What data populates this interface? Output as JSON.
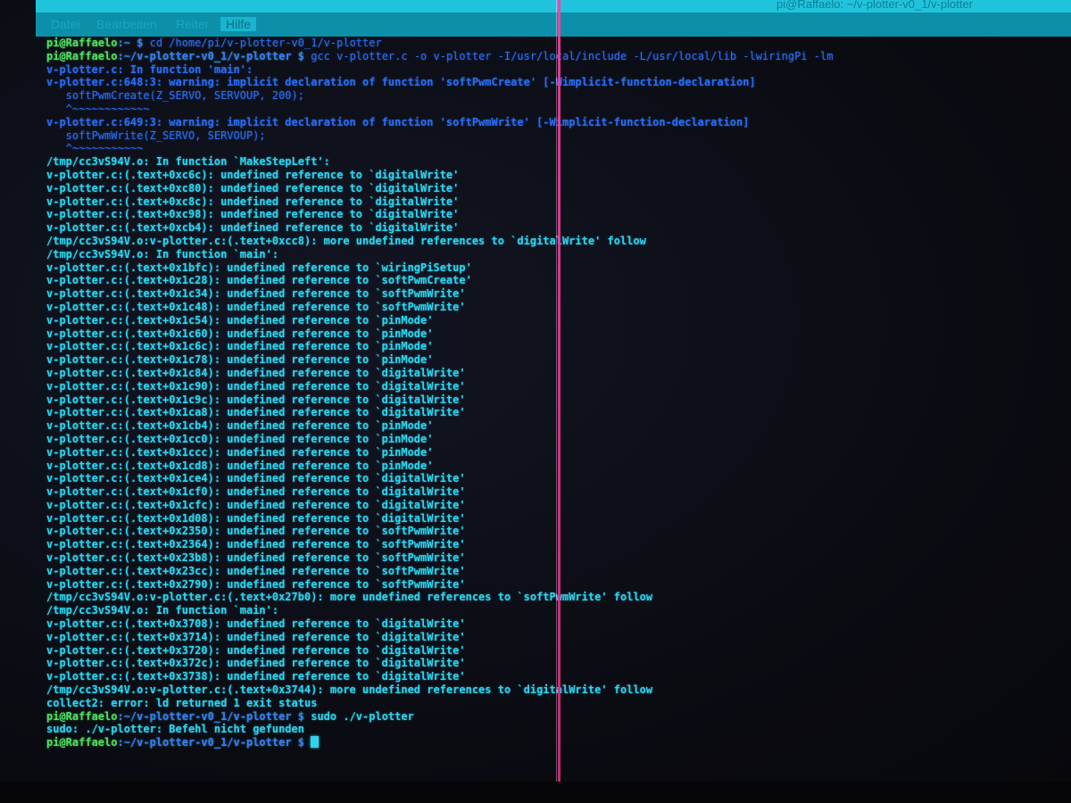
{
  "window": {
    "title": "pi@Raffaelo: ~/v-plotter-v0_1/v-plotter"
  },
  "menu": {
    "items": [
      "Datei",
      "Bearbeiten",
      "Reiter",
      "Hilfe"
    ]
  },
  "colors": {
    "titlebar": "#1fc4dc",
    "menubar": "#0c8fa9",
    "background": "#0c0d14",
    "text": "#2fd3ee",
    "prompt_user": "#4fe060",
    "prompt_path": "#3b7cf5",
    "cursor": "#2fd3ee",
    "artifact_line": "#ff3ea8"
  },
  "terminal": {
    "prompt1": {
      "user": "pi@Raffaelo",
      "path": ":~ $",
      "command": " cd /home/pi/v-plotter-v0_1/v-plotter"
    },
    "prompt2": {
      "user": "pi@Raffaelo",
      "path": ":~/v-plotter-v0_1/v-plotter $",
      "command": " gcc v-plotter.c -o v-plotter -I/usr/local/include -L/usr/local/lib -lwiringPi -lm"
    },
    "warnings": {
      "in_function": "v-plotter.c: In function 'main':",
      "w1": "v-plotter.c:648:3: warning: implicit declaration of function 'softPwmCreate' [-Wimplicit-function-declaration]",
      "w1_code": "   softPwmCreate(Z_SERVO, SERVOUP, 200);",
      "w1_marker": "   ^~~~~~~~~~~~~",
      "w2": "v-plotter.c:649:3: warning: implicit declaration of function 'softPwmWrite' [-Wimplicit-function-declaration]",
      "w2_code": "   softPwmWrite(Z_SERVO, SERVOUP);",
      "w2_marker": "   ^~~~~~~~~~~~"
    },
    "linker_lines": [
      "/tmp/cc3vS94V.o: In function `MakeStepLeft':",
      "v-plotter.c:(.text+0xc6c): undefined reference to `digitalWrite'",
      "v-plotter.c:(.text+0xc80): undefined reference to `digitalWrite'",
      "v-plotter.c:(.text+0xc8c): undefined reference to `digitalWrite'",
      "v-plotter.c:(.text+0xc98): undefined reference to `digitalWrite'",
      "v-plotter.c:(.text+0xcb4): undefined reference to `digitalWrite'",
      "/tmp/cc3vS94V.o:v-plotter.c:(.text+0xcc8): more undefined references to `digitalWrite' follow",
      "/tmp/cc3vS94V.o: In function `main':",
      "v-plotter.c:(.text+0x1bfc): undefined reference to `wiringPiSetup'",
      "v-plotter.c:(.text+0x1c28): undefined reference to `softPwmCreate'",
      "v-plotter.c:(.text+0x1c34): undefined reference to `softPwmWrite'",
      "v-plotter.c:(.text+0x1c48): undefined reference to `softPwmWrite'",
      "v-plotter.c:(.text+0x1c54): undefined reference to `pinMode'",
      "v-plotter.c:(.text+0x1c60): undefined reference to `pinMode'",
      "v-plotter.c:(.text+0x1c6c): undefined reference to `pinMode'",
      "v-plotter.c:(.text+0x1c78): undefined reference to `pinMode'",
      "v-plotter.c:(.text+0x1c84): undefined reference to `digitalWrite'",
      "v-plotter.c:(.text+0x1c90): undefined reference to `digitalWrite'",
      "v-plotter.c:(.text+0x1c9c): undefined reference to `digitalWrite'",
      "v-plotter.c:(.text+0x1ca8): undefined reference to `digitalWrite'",
      "v-plotter.c:(.text+0x1cb4): undefined reference to `pinMode'",
      "v-plotter.c:(.text+0x1cc0): undefined reference to `pinMode'",
      "v-plotter.c:(.text+0x1ccc): undefined reference to `pinMode'",
      "v-plotter.c:(.text+0x1cd8): undefined reference to `pinMode'",
      "v-plotter.c:(.text+0x1ce4): undefined reference to `digitalWrite'",
      "v-plotter.c:(.text+0x1cf0): undefined reference to `digitalWrite'",
      "v-plotter.c:(.text+0x1cfc): undefined reference to `digitalWrite'",
      "v-plotter.c:(.text+0x1d08): undefined reference to `digitalWrite'",
      "v-plotter.c:(.text+0x2350): undefined reference to `softPwmWrite'",
      "v-plotter.c:(.text+0x2364): undefined reference to `softPwmWrite'",
      "v-plotter.c:(.text+0x23b8): undefined reference to `softPwmWrite'",
      "v-plotter.c:(.text+0x23cc): undefined reference to `softPwmWrite'",
      "v-plotter.c:(.text+0x2790): undefined reference to `softPwmWrite'",
      "/tmp/cc3vS94V.o:v-plotter.c:(.text+0x27b0): more undefined references to `softPwmWrite' follow",
      "/tmp/cc3vS94V.o: In function `main':",
      "v-plotter.c:(.text+0x3708): undefined reference to `digitalWrite'",
      "v-plotter.c:(.text+0x3714): undefined reference to `digitalWrite'",
      "v-plotter.c:(.text+0x3720): undefined reference to `digitalWrite'",
      "v-plotter.c:(.text+0x372c): undefined reference to `digitalWrite'",
      "v-plotter.c:(.text+0x3738): undefined reference to `digitalWrite'",
      "/tmp/cc3vS94V.o:v-plotter.c:(.text+0x3744): more undefined references to `digitalWrite' follow",
      "collect2: error: ld returned 1 exit status"
    ],
    "prompt3": {
      "user": "pi@Raffaelo",
      "path": ":~/v-plotter-v0_1/v-plotter $",
      "command": " sudo ./v-plotter"
    },
    "sudo_error": "sudo: ./v-plotter: Befehl nicht gefunden",
    "prompt4": {
      "user": "pi@Raffaelo",
      "path": ":~/v-plotter-v0_1/v-plotter $",
      "command": " "
    }
  }
}
